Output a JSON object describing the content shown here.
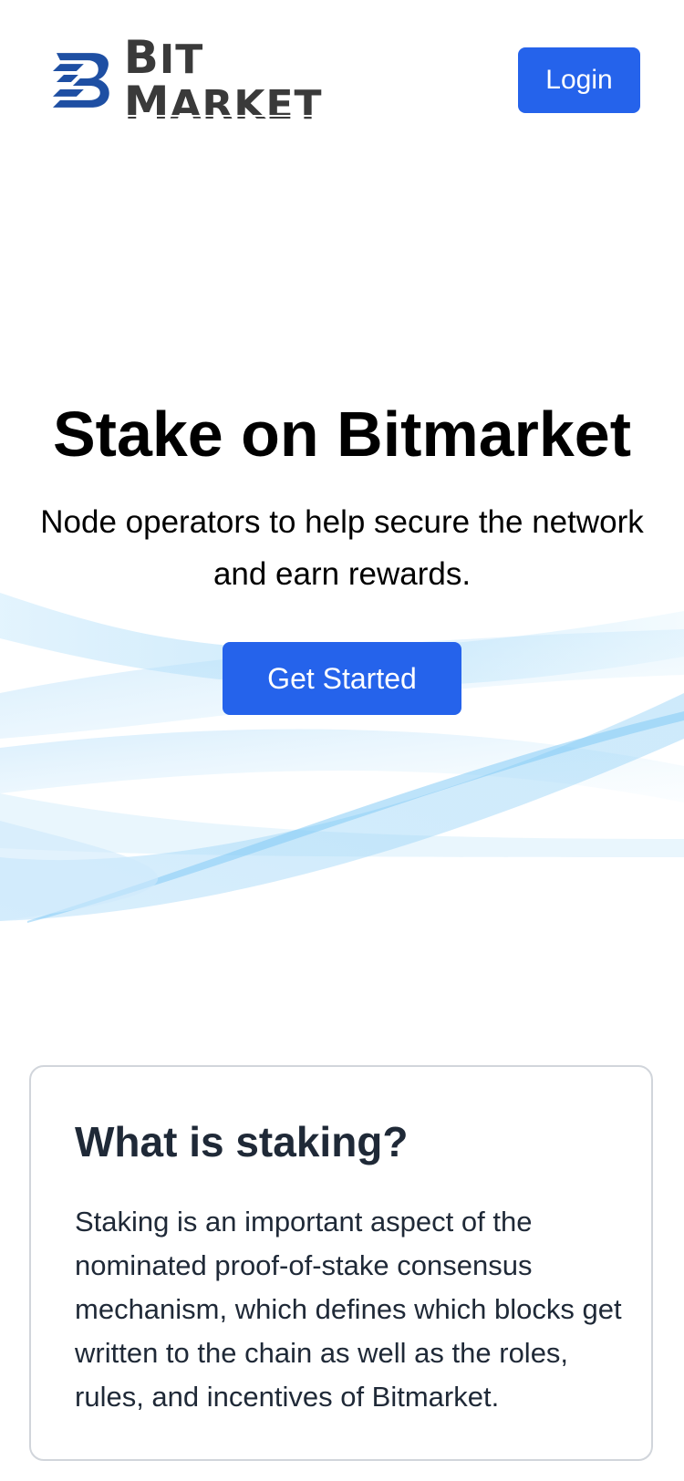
{
  "brand": {
    "name_first": "B",
    "name_rest": "IT ",
    "name_second": "M",
    "name_second_rest": "ARKET",
    "logo_icon": "bitmarket-b-logo-icon",
    "logo_color": "#1e4fa3"
  },
  "header": {
    "login_label": "Login"
  },
  "hero": {
    "title": "Stake on Bitmarket",
    "subtitle": "Node operators to help secure the network and earn rewards.",
    "cta_label": "Get Started"
  },
  "info_card": {
    "title": "What is staking?",
    "body": "Staking is an important aspect of the nominated proof-of-stake consensus mechanism, which defines which blocks get written to the chain as well as the roles, rules, and incentives of Bitmarket."
  },
  "colors": {
    "accent": "#2563eb",
    "text_dark": "#1f2937",
    "card_border": "#d1d5db",
    "wave_light": "#bfe6fb",
    "wave_mid": "#7cc8f5"
  }
}
